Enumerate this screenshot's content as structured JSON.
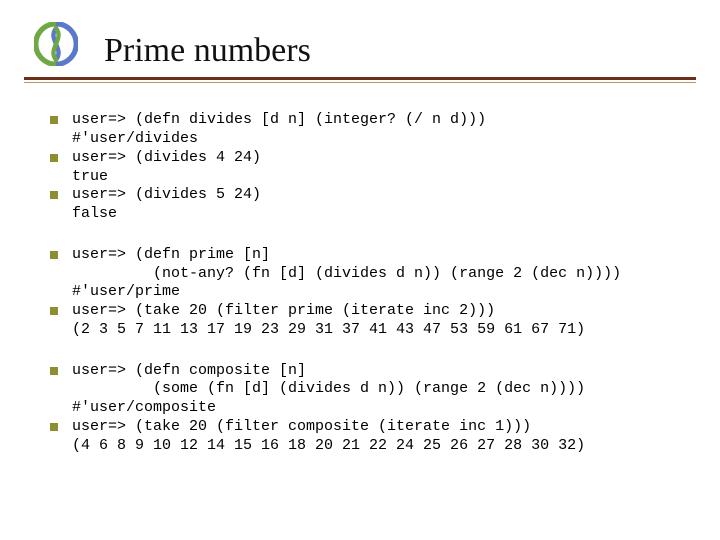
{
  "title": "Prime numbers",
  "groups": [
    {
      "items": [
        {
          "lines": [
            "user=> (defn divides [d n] (integer? (/ n d)))",
            "#'user/divides"
          ]
        },
        {
          "lines": [
            "user=> (divides 4 24)",
            "true"
          ]
        },
        {
          "lines": [
            "user=> (divides 5 24)",
            "false"
          ]
        }
      ]
    },
    {
      "items": [
        {
          "lines": [
            "user=> (defn prime [n]",
            "         (not-any? (fn [d] (divides d n)) (range 2 (dec n))))",
            "#'user/prime"
          ]
        },
        {
          "lines": [
            "user=> (take 20 (filter prime (iterate inc 2)))",
            "(2 3 5 7 11 13 17 19 23 29 31 37 41 43 47 53 59 61 67 71)"
          ]
        }
      ]
    },
    {
      "items": [
        {
          "lines": [
            "user=> (defn composite [n]",
            "         (some (fn [d] (divides d n)) (range 2 (dec n))))",
            "#'user/composite"
          ]
        },
        {
          "lines": [
            "user=> (take 20 (filter composite (iterate inc 1)))",
            "(4 6 8 9 10 12 14 15 16 18 20 21 22 24 25 26 27 28 30 32)"
          ]
        }
      ]
    }
  ]
}
